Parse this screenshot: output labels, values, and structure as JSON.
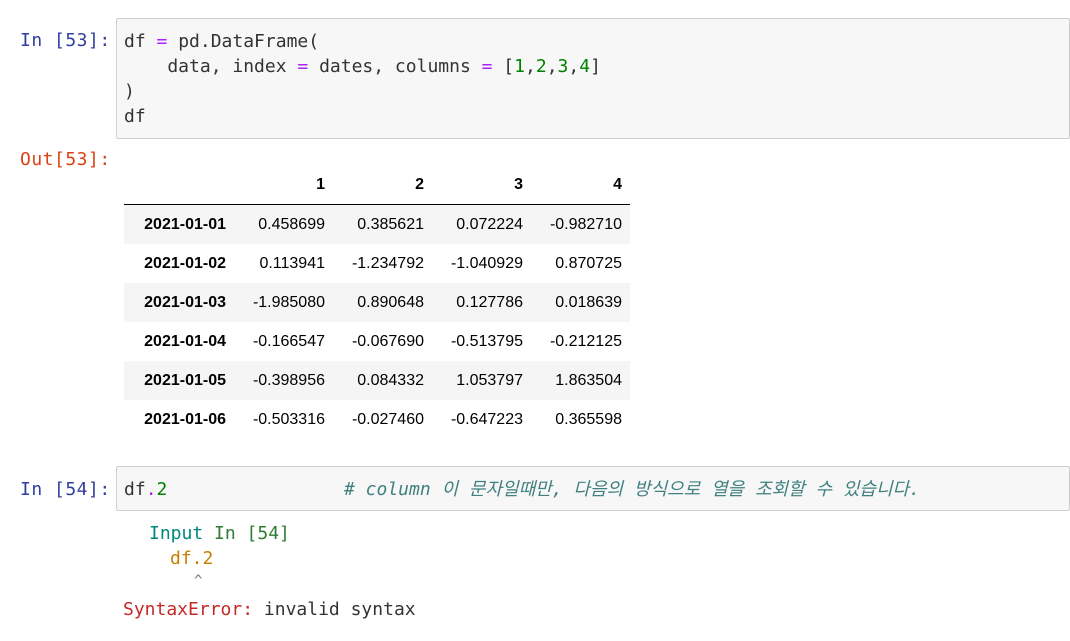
{
  "cell53": {
    "in_prompt": "In [53]:",
    "out_prompt": "Out[53]:",
    "code": {
      "l1_a": "df ",
      "l1_op": "=",
      "l1_b": " pd.DataFrame(",
      "l2_a": "    data, index ",
      "l2_op1": "=",
      "l2_b": " dates, columns ",
      "l2_op2": "=",
      "l2_c": " [",
      "n1": "1",
      "comma1": ",",
      "n2": "2",
      "comma2": ",",
      "n3": "3",
      "comma3": ",",
      "n4": "4",
      "l2_d": "]",
      "l3": ")",
      "l4": "df"
    }
  },
  "dataframe": {
    "columns": [
      "",
      "1",
      "2",
      "3",
      "4"
    ],
    "rows": [
      {
        "index": "2021-01-01",
        "values": [
          "0.458699",
          "0.385621",
          "0.072224",
          "-0.982710"
        ]
      },
      {
        "index": "2021-01-02",
        "values": [
          "0.113941",
          "-1.234792",
          "-1.040929",
          "0.870725"
        ]
      },
      {
        "index": "2021-01-03",
        "values": [
          "-1.985080",
          "0.890648",
          "0.127786",
          "0.018639"
        ]
      },
      {
        "index": "2021-01-04",
        "values": [
          "-0.166547",
          "-0.067690",
          "-0.513795",
          "-0.212125"
        ]
      },
      {
        "index": "2021-01-05",
        "values": [
          "-0.398956",
          "0.084332",
          "1.053797",
          "1.863504"
        ]
      },
      {
        "index": "2021-01-06",
        "values": [
          "-0.503316",
          "-0.027460",
          "-0.647223",
          "0.365598"
        ]
      }
    ]
  },
  "cell54": {
    "in_prompt": "In [54]:",
    "code_a": "df",
    "code_op": ".",
    "code_num": "2",
    "comment": "# column 이 문자일때만, 다음의 방식으로 열을 조회할 수 있습니다.",
    "error": {
      "input_label": "Input",
      "input_cell": "In [54]",
      "code_line": "df.2",
      "caret": "^",
      "error_type": "SyntaxError",
      "colon": ":",
      "message": " invalid syntax"
    }
  },
  "colors": {
    "in_prompt": "#303f9f",
    "out_prompt": "#d84315",
    "cell_bg": "#f7f7f7",
    "operator": "#aa22ff",
    "number": "#008000",
    "comment": "#408080",
    "error_red": "#c62828",
    "traceback_green": "#00897b",
    "traceback_orange": "#c58000"
  }
}
